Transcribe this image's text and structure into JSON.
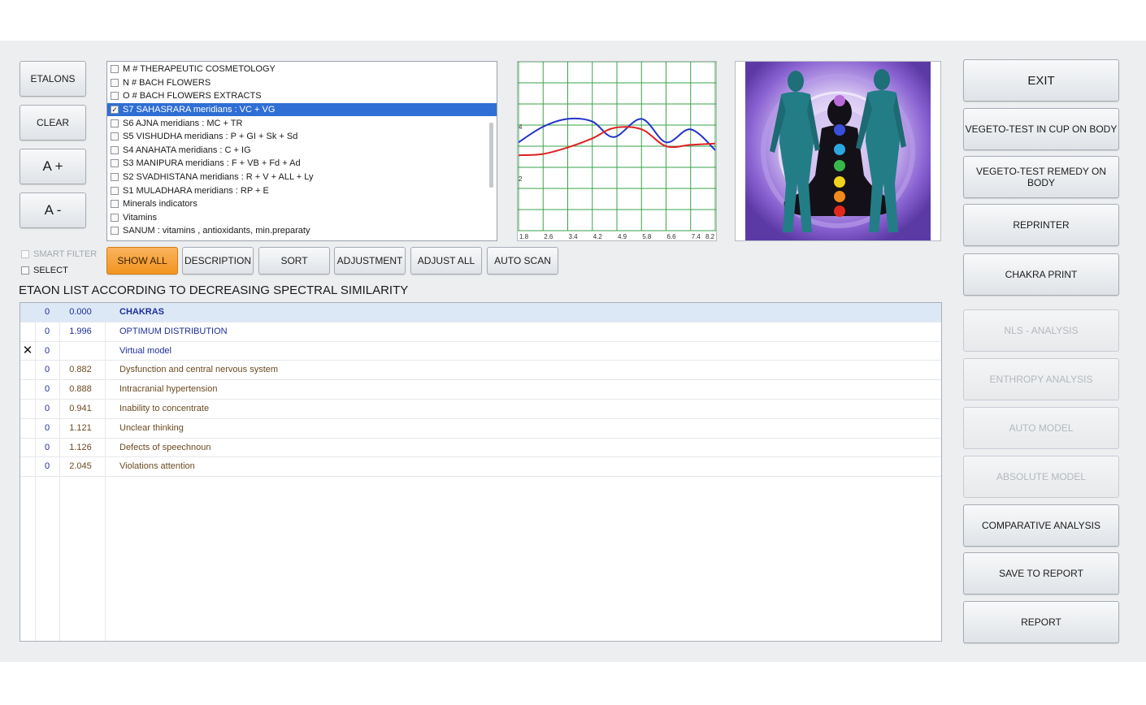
{
  "left_buttons": {
    "etalons": "ETALONS",
    "clear": "CLEAR",
    "a_plus": "A +",
    "a_minus": "A -"
  },
  "checkboxes": {
    "smart_filter": "SMART FILTER",
    "select": "SELECT"
  },
  "etalon_list": [
    {
      "label": "M # THERAPEUTIC COSMETOLOGY",
      "checked": false
    },
    {
      "label": "N # BACH FLOWERS",
      "checked": false
    },
    {
      "label": "O # BACH FLOWERS EXTRACTS",
      "checked": false
    },
    {
      "label": "S7 SAHASRARA meridians : VC + VG",
      "checked": true,
      "selected": true
    },
    {
      "label": "S6 AJNA meridians : MC + TR",
      "checked": false
    },
    {
      "label": "S5 VISHUDHA meridians : P + GI + Sk + Sd",
      "checked": false
    },
    {
      "label": "S4 ANAHATA meridians : C + IG",
      "checked": false
    },
    {
      "label": "S3 MANIPURA meridians : F + VB + Fd + Ad",
      "checked": false
    },
    {
      "label": "S2 SVADHISTANA meridians : R + V + ALL + Ly",
      "checked": false
    },
    {
      "label": "S1 MULADHARA meridians : RP + E",
      "checked": false
    },
    {
      "label": "Minerals indicators",
      "checked": false
    },
    {
      "label": "Vitamins",
      "checked": false
    },
    {
      "label": "SANUM : vitamins , antioxidants, min.preparaty",
      "checked": false
    }
  ],
  "chart_data": {
    "type": "line",
    "x_ticks": [
      "1.8",
      "2.6",
      "3.4",
      "4.2",
      "4.9",
      "5.8",
      "6.6",
      "7.4",
      "8.2"
    ],
    "y_ticks": [
      "4",
      "2"
    ],
    "xlim": [
      1.8,
      8.2
    ],
    "ylim": [
      0,
      6.5
    ],
    "grid": true,
    "series": [
      {
        "color": "#2233cc",
        "x": [
          1.8,
          2.6,
          3.4,
          4.2,
          4.9,
          5.8,
          6.6,
          7.4,
          8.2
        ],
        "y": [
          3.4,
          4.0,
          4.3,
          4.2,
          3.6,
          4.3,
          3.4,
          3.9,
          3.1
        ]
      },
      {
        "color": "#dd2222",
        "x": [
          1.8,
          2.6,
          3.4,
          4.2,
          4.9,
          5.8,
          6.6,
          7.4,
          8.2
        ],
        "y": [
          2.9,
          2.95,
          3.2,
          3.55,
          3.95,
          3.9,
          3.25,
          3.3,
          3.35
        ]
      }
    ]
  },
  "toolbar": {
    "show_all": "SHOW ALL",
    "description": "DESCRIPTION",
    "sort": "SORT",
    "adjustment": "ADJUSTMENT",
    "adjust_all": "ADJUST ALL",
    "auto_scan": "AUTO SCAN"
  },
  "results_title": "ETAON LIST ACCORDING TO DECREASING SPECTRAL SIMILARITY",
  "results": [
    {
      "mark": "",
      "n": "0",
      "value": "0.000",
      "name": "CHAKRAS",
      "style": "header"
    },
    {
      "mark": "",
      "n": "0",
      "value": "1.996",
      "name": "OPTIMUM DISTRIBUTION",
      "style": "blue"
    },
    {
      "mark": "✕",
      "n": "0",
      "value": "",
      "name": "Virtual model",
      "style": "blue"
    },
    {
      "mark": "",
      "n": "0",
      "value": "0.882",
      "name": "Dysfunction and central nervous system",
      "style": "brown"
    },
    {
      "mark": "",
      "n": "0",
      "value": "0.888",
      "name": "Intracranial hypertension",
      "style": "brown"
    },
    {
      "mark": "",
      "n": "0",
      "value": "0.941",
      "name": "Inability to concentrate",
      "style": "brown"
    },
    {
      "mark": "",
      "n": "0",
      "value": "1.121",
      "name": "Unclear thinking",
      "style": "brown"
    },
    {
      "mark": "",
      "n": "0",
      "value": "1.126",
      "name": "Defects of speechnoun",
      "style": "brown"
    },
    {
      "mark": "",
      "n": "0",
      "value": "2.045",
      "name": "Violations attention",
      "style": "brown"
    }
  ],
  "right_buttons": [
    {
      "label": "EXIT",
      "enabled": true
    },
    {
      "label": "VEGETO-TEST IN CUP ON BODY",
      "enabled": true
    },
    {
      "label": "VEGETO-TEST REMEDY ON BODY",
      "enabled": true
    },
    {
      "label": "REPRINTER",
      "enabled": true
    },
    {
      "label": "CHAKRA PRINT",
      "enabled": true
    },
    {
      "label": "NLS - ANALYSIS",
      "enabled": false
    },
    {
      "label": "ENTHROPY ANALYSIS",
      "enabled": false
    },
    {
      "label": "AUTO MODEL",
      "enabled": false
    },
    {
      "label": "ABSOLUTE MODEL",
      "enabled": false
    },
    {
      "label": "COMPARATIVE ANALYSIS",
      "enabled": true
    },
    {
      "label": "SAVE TO REPORT",
      "enabled": true
    },
    {
      "label": "REPORT",
      "enabled": true
    }
  ],
  "colors": {
    "accent": "#f29420",
    "selection": "#2f6ed4",
    "row_highlight": "#dce8f6",
    "link_blue": "#1f2e99",
    "brown_text": "#6b4a22",
    "chakra_purple": "#8a63d2"
  }
}
